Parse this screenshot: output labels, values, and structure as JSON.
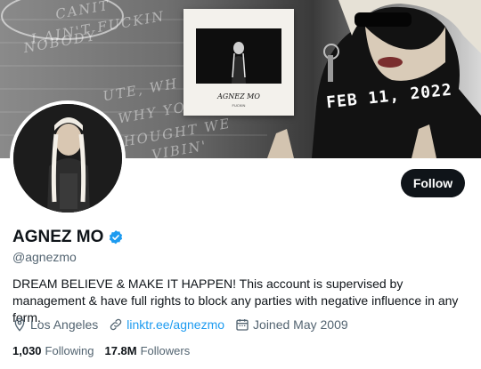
{
  "banner": {
    "scrawl_lines": [
      "CANIT",
      "I AIN'T FUCKIN",
      "NOBODY"
    ],
    "scrawl_lines_2": [
      "UTE, WH",
      "WHY YO",
      "HOUGHT WE",
      "VIBIN'"
    ],
    "album_title": "AGNEZ MO",
    "album_subtitle": "FUCKIN",
    "date_text": "FEB 11, 2022"
  },
  "profile": {
    "display_name": "AGNEZ MO",
    "handle": "@agnezmo",
    "bio": "DREAM BELIEVE & MAKE IT HAPPEN! This account is supervised by management & have full rights to block any parties with negative influence in any form.",
    "location": "Los Angeles",
    "website": "linktr.ee/agnezmo",
    "joined": "Joined May 2009",
    "following_count": "1,030",
    "following_label": "Following",
    "followers_count": "17.8M",
    "followers_label": "Followers",
    "follow_button": "Follow"
  },
  "icons": {
    "verified": "verified-badge-icon",
    "location": "location-pin-icon",
    "link": "link-icon",
    "calendar": "calendar-icon"
  },
  "colors": {
    "accent": "#1d9bf0",
    "text": "#0f1419",
    "muted": "#536471",
    "button_bg": "#0f1419"
  }
}
